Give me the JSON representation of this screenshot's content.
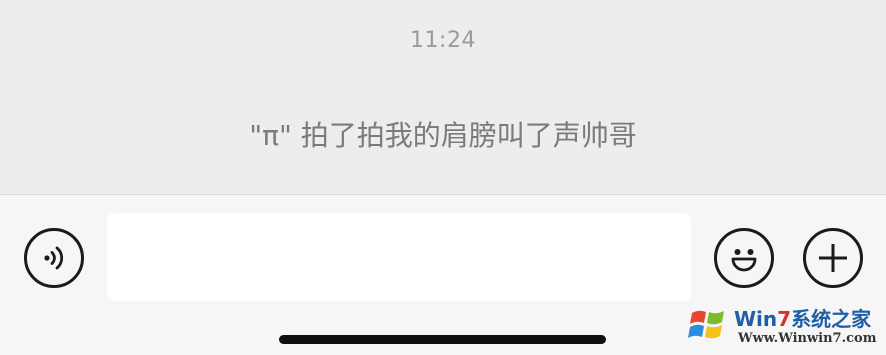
{
  "chat": {
    "timestamp": "11:24",
    "system_message": "\"π\" 拍了拍我的肩膀叫了声帅哥"
  },
  "input_bar": {
    "message_value": "",
    "message_placeholder": "",
    "voice_icon": "voice-input-icon",
    "emoji_icon": "emoji-smile-icon",
    "more_icon": "plus-icon"
  },
  "watermark": {
    "title_prefix": "Win",
    "title_seven": "7",
    "title_suffix": "系统之家",
    "url": "Www.Winwin7.com"
  }
}
